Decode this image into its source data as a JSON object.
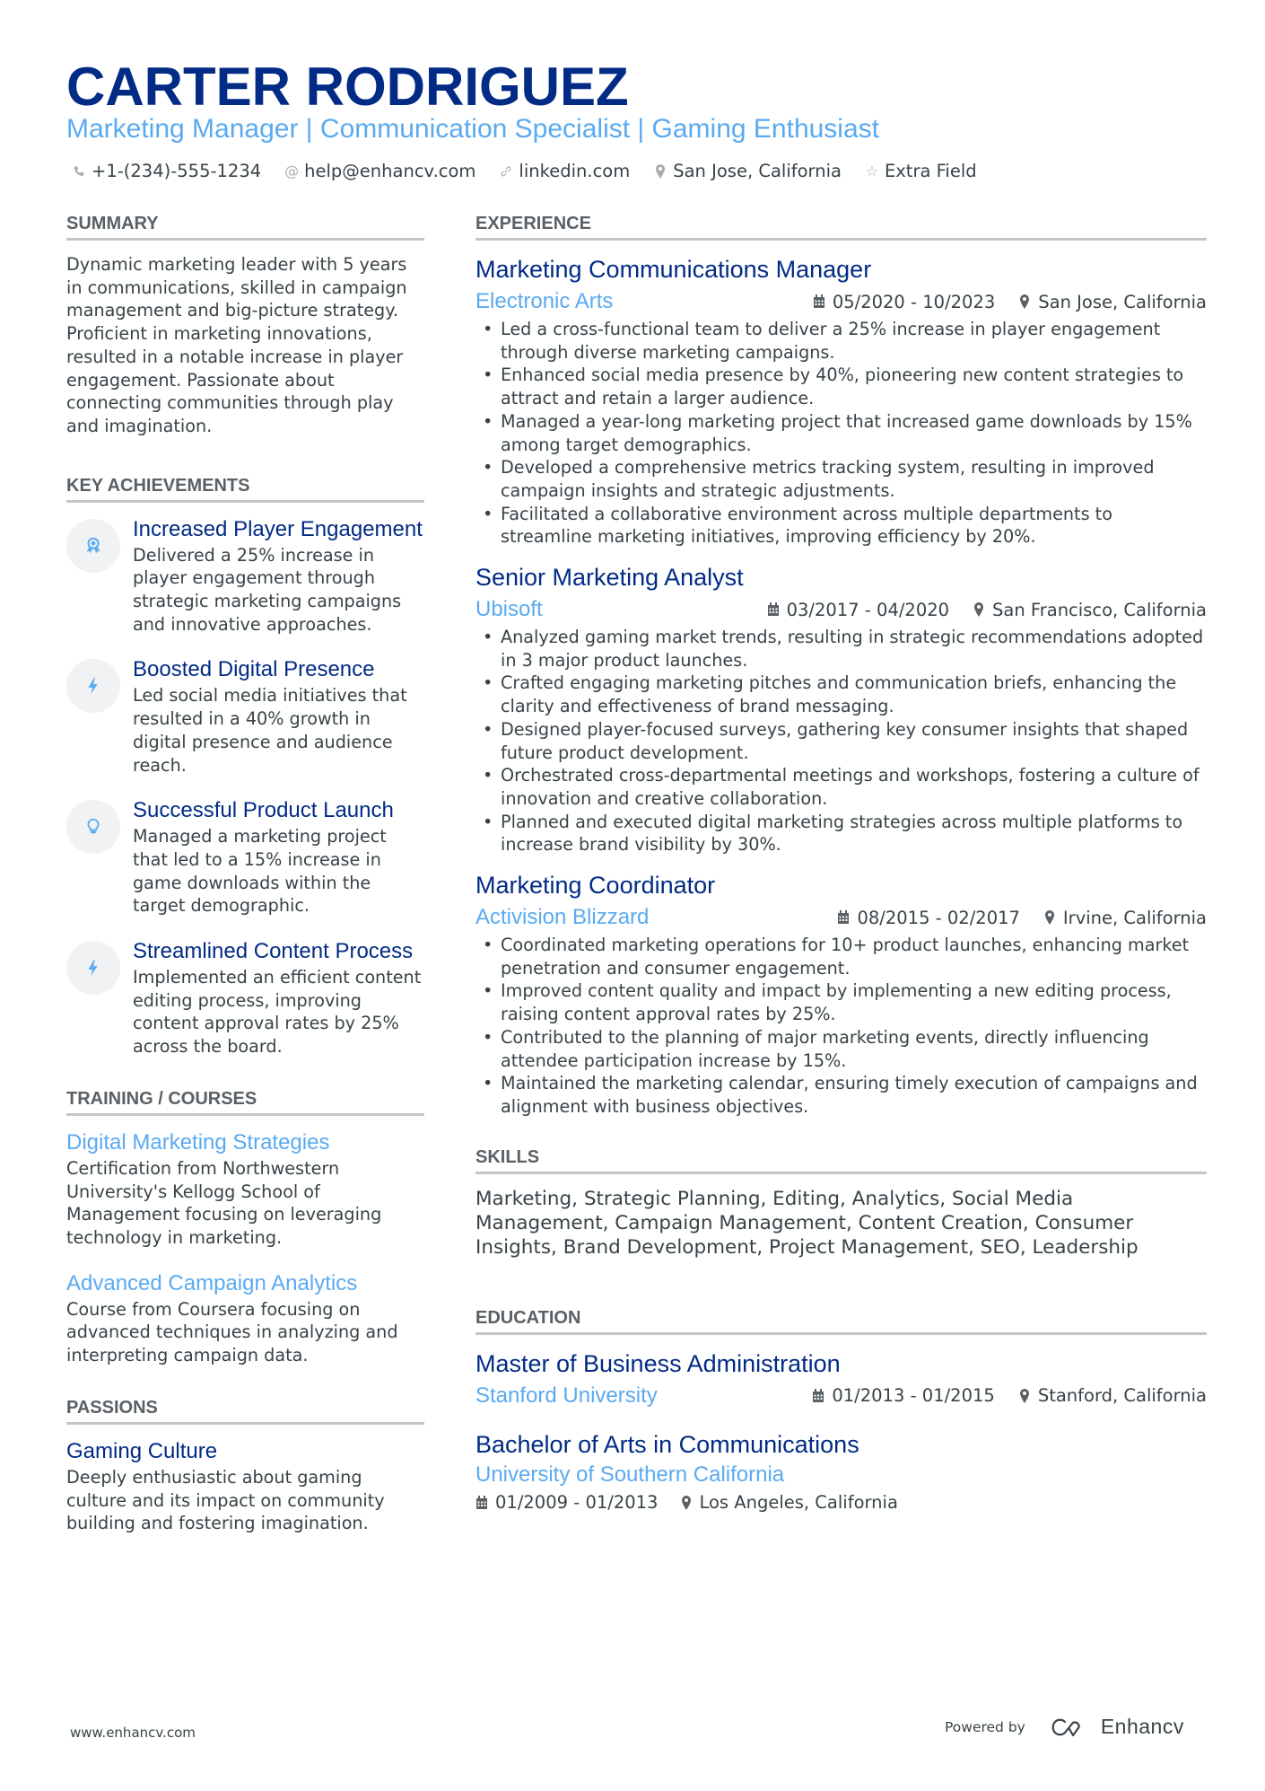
{
  "header": {
    "name": "CARTER RODRIGUEZ",
    "tagline": "Marketing Manager | Communication Specialist | Gaming Enthusiast",
    "contacts": [
      {
        "icon": "phone-icon",
        "glyph": "✆",
        "text": "+1-(234)-555-1234"
      },
      {
        "icon": "at-icon",
        "glyph": "@",
        "text": "help@enhancv.com"
      },
      {
        "icon": "link-icon",
        "glyph": "🔗",
        "text": "linkedin.com"
      },
      {
        "icon": "location-icon",
        "glyph": "📍",
        "text": "San Jose, California"
      },
      {
        "icon": "star-icon",
        "glyph": "☆",
        "text": "Extra Field"
      }
    ]
  },
  "summary": {
    "title": "SUMMARY",
    "text": "Dynamic marketing leader with 5 years in communications, skilled in campaign management and big-picture strategy. Proficient in marketing innovations, resulted in a notable increase in player engagement. Passionate about connecting communities through play and imagination."
  },
  "achievements": {
    "title": "KEY ACHIEVEMENTS",
    "items": [
      {
        "icon": "award-medal-icon",
        "title": "Increased Player Engagement",
        "text": "Delivered a 25% increase in player engagement through strategic marketing campaigns and innovative approaches."
      },
      {
        "icon": "lightning-bolt-icon",
        "title": "Boosted Digital Presence",
        "text": "Led social media initiatives that resulted in a 40% growth in digital presence and audience reach."
      },
      {
        "icon": "lightbulb-icon",
        "title": "Successful Product Launch",
        "text": "Managed a marketing project that led to a 15% increase in game downloads within the target demographic."
      },
      {
        "icon": "lightning-bolt-icon",
        "title": "Streamlined Content Process",
        "text": "Implemented an efficient content editing process, improving content approval rates by 25% across the board."
      }
    ]
  },
  "training": {
    "title": "TRAINING / COURSES",
    "items": [
      {
        "title": "Digital Marketing Strategies",
        "text": "Certification from Northwestern University's Kellogg School of Management focusing on leveraging technology in marketing."
      },
      {
        "title": "Advanced Campaign Analytics",
        "text": "Course from Coursera focusing on advanced techniques in analyzing and interpreting campaign data."
      }
    ]
  },
  "passions": {
    "title": "PASSIONS",
    "items": [
      {
        "title": "Gaming Culture",
        "text": "Deeply enthusiastic about gaming culture and its impact on community building and fostering imagination."
      }
    ]
  },
  "experience": {
    "title": "EXPERIENCE",
    "jobs": [
      {
        "title": "Marketing Communications Manager",
        "company": "Electronic Arts",
        "dates": "05/2020 - 10/2023",
        "location": "San Jose, California",
        "bullets": [
          "Led a cross-functional team to deliver a 25% increase in player engagement through diverse marketing campaigns.",
          "Enhanced social media presence by 40%, pioneering new content strategies to attract and retain a larger audience.",
          "Managed a year-long marketing project that increased game downloads by 15% among target demographics.",
          "Developed a comprehensive metrics tracking system, resulting in improved campaign insights and strategic adjustments.",
          "Facilitated a collaborative environment across multiple departments to streamline marketing initiatives, improving efficiency by 20%."
        ]
      },
      {
        "title": "Senior Marketing Analyst",
        "company": "Ubisoft",
        "dates": "03/2017 - 04/2020",
        "location": "San Francisco, California",
        "bullets": [
          "Analyzed gaming market trends, resulting in strategic recommendations adopted in 3 major product launches.",
          "Crafted engaging marketing pitches and communication briefs, enhancing the clarity and effectiveness of brand messaging.",
          "Designed player-focused surveys, gathering key consumer insights that shaped future product development.",
          "Orchestrated cross-departmental meetings and workshops, fostering a culture of innovation and creative collaboration.",
          "Planned and executed digital marketing strategies across multiple platforms to increase brand visibility by 30%."
        ]
      },
      {
        "title": "Marketing Coordinator",
        "company": "Activision Blizzard",
        "dates": "08/2015 - 02/2017",
        "location": "Irvine, California",
        "bullets": [
          "Coordinated marketing operations for 10+ product launches, enhancing market penetration and consumer engagement.",
          "Improved content quality and impact by implementing a new editing process, raising content approval rates by 25%.",
          "Contributed to the planning of major marketing events, directly influencing attendee participation increase by 15%.",
          "Maintained the marketing calendar, ensuring timely execution of campaigns and alignment with business objectives."
        ]
      }
    ]
  },
  "skills": {
    "title": "SKILLS",
    "text": "Marketing, Strategic Planning, Editing, Analytics, Social Media Management, Campaign Management, Content Creation, Consumer Insights, Brand Development, Project Management, SEO, Leadership"
  },
  "education": {
    "title": "EDUCATION",
    "items": [
      {
        "degree": "Master of Business Administration",
        "school": "Stanford University",
        "dates": "01/2013 - 01/2015",
        "location": "Stanford, California"
      },
      {
        "degree": "Bachelor of Arts in Communications",
        "school": "University of Southern California",
        "dates": "01/2009 - 01/2013",
        "location": "Los Angeles, California"
      }
    ]
  },
  "footer": {
    "website": "www.enhancv.com",
    "powered_by": "Powered by",
    "brand": "Enhancv"
  },
  "colors": {
    "name": "#022b85",
    "accent": "#5aaaf0",
    "text": "#384347",
    "rule": "#c3c6c8"
  }
}
